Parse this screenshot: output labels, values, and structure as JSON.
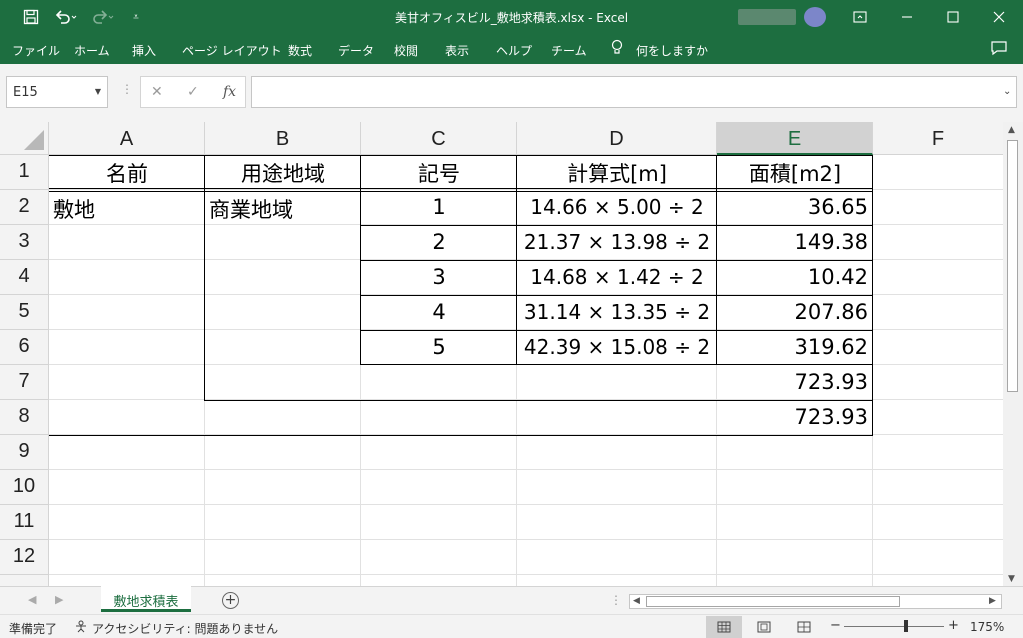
{
  "window": {
    "title": "美甘オフィスビル_敷地求積表.xlsx  -  Excel",
    "minimize_icon": "minimize-icon",
    "restore_icon": "ribbon-display-icon",
    "maximize_icon": "maximize-icon",
    "close_icon": "close-icon"
  },
  "quick_access": {
    "save_icon": "save-icon",
    "undo_icon": "undo-icon",
    "redo_icon": "redo-icon",
    "customize_icon": "customize-icon"
  },
  "menu": {
    "items": [
      "ファイル",
      "ホーム",
      "挿入",
      "ページ レイアウト",
      "数式",
      "データ",
      "校閲",
      "表示",
      "ヘルプ",
      "チーム"
    ],
    "tell_me": "何をしますか",
    "share_icon": "comment-icon"
  },
  "formula_bar": {
    "name_box": "E15",
    "cancel_icon": "✕",
    "enter_icon": "✓",
    "fx_label": "fx",
    "formula_value": ""
  },
  "grid": {
    "columns": [
      "A",
      "B",
      "C",
      "D",
      "E",
      "F"
    ],
    "selected_column": "E",
    "rows": [
      "1",
      "2",
      "3",
      "4",
      "5",
      "6",
      "7",
      "8",
      "9",
      "10",
      "11",
      "12"
    ],
    "cells": {
      "A1": "名前",
      "B1": "用途地域",
      "C1": "記号",
      "D1": "計算式[m]",
      "E1": "面積[m2]",
      "A2": "敷地",
      "B2": "商業地域",
      "C2": "1",
      "D2": "14.66 × 5.00 ÷ 2",
      "E2": "36.65",
      "C3": "2",
      "D3": "21.37 × 13.98 ÷ 2",
      "E3": "149.38",
      "C4": "3",
      "D4": "14.68 × 1.42 ÷ 2",
      "E4": "10.42",
      "C5": "4",
      "D5": "31.14 × 13.35 ÷ 2",
      "E5": "207.86",
      "C6": "5",
      "D6": "42.39 × 15.08 ÷ 2",
      "E6": "319.62",
      "E7": "723.93",
      "E8": "723.93"
    }
  },
  "sheets": {
    "tabs": [
      "敷地求積表"
    ],
    "active": "敷地求積表",
    "add_icon": "+"
  },
  "status_bar": {
    "ready": "準備完了",
    "accessibility": "アクセシビリティ: 問題ありません",
    "zoom": "175%"
  },
  "colors": {
    "brand": "#1d6e40",
    "header_bg": "#f3f3f3",
    "gridline": "#e1e1e1"
  }
}
